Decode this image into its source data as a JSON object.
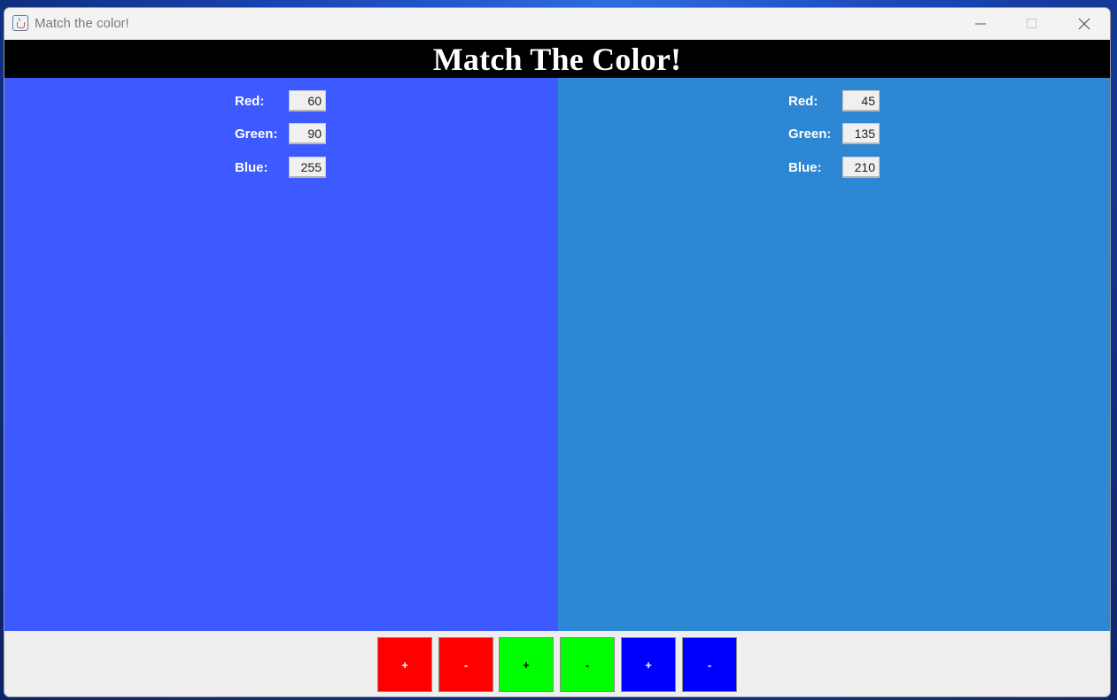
{
  "window": {
    "title": "Match the color!",
    "icon": "java-cup-icon",
    "controls": [
      "minimize-icon",
      "maximize-icon",
      "close-icon"
    ]
  },
  "header": {
    "title": "Match The Color!"
  },
  "panels": {
    "left": {
      "color": "#3c5aff",
      "fields": [
        {
          "label": "Red:",
          "value": "60"
        },
        {
          "label": "Green:",
          "value": "90"
        },
        {
          "label": "Blue:",
          "value": "255"
        }
      ]
    },
    "right": {
      "color": "#2d87d2",
      "fields": [
        {
          "label": "Red:",
          "value": "45"
        },
        {
          "label": "Green:",
          "value": "135"
        },
        {
          "label": "Blue:",
          "value": "210"
        }
      ]
    }
  },
  "controls": {
    "buttons": [
      {
        "label": "+",
        "color": "#ff0000",
        "text_color": "#ffffff"
      },
      {
        "label": "-",
        "color": "#ff0000",
        "text_color": "#ffffff"
      },
      {
        "label": "+",
        "color": "#00ff00",
        "text_color": "#000000"
      },
      {
        "label": "-",
        "color": "#00ff00",
        "text_color": "#000000"
      },
      {
        "label": "+",
        "color": "#0000ff",
        "text_color": "#ffffff"
      },
      {
        "label": "-",
        "color": "#0000ff",
        "text_color": "#ffffff"
      }
    ]
  }
}
